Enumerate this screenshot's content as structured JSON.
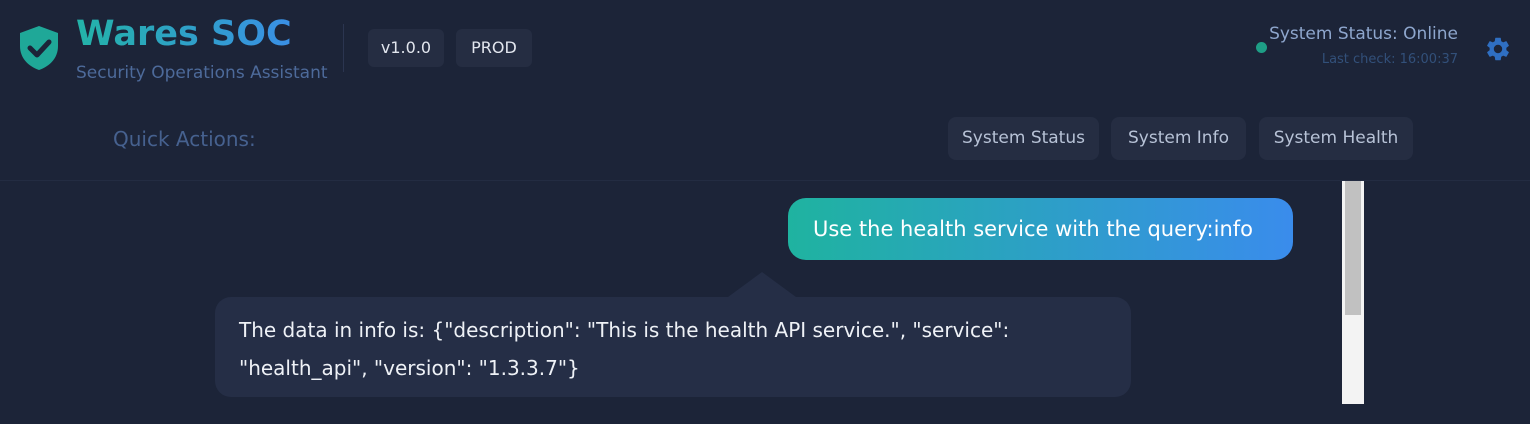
{
  "brand": {
    "title": "Wares SOC",
    "subtitle": "Security Operations Assistant",
    "logo_icon": "shield-check-icon"
  },
  "badges": {
    "version": "v1.0.0",
    "environment": "PROD"
  },
  "status": {
    "text": "System Status: Online",
    "last_check": "Last check: 16:00:37",
    "indicator_color": "#1e9e86"
  },
  "settings": {
    "icon": "gear-icon"
  },
  "quick_actions": {
    "label": "Quick Actions:",
    "buttons": [
      {
        "label": "System Status"
      },
      {
        "label": "System Info"
      },
      {
        "label": "System Health"
      }
    ]
  },
  "chat": {
    "messages": [
      {
        "role": "user",
        "text": "Use the health service with the query:info"
      },
      {
        "role": "assistant",
        "text": "The data in info is: {\"description\": \"This is the health API service.\", \"service\": \"health_api\", \"version\": \"1.3.3.7\"}"
      }
    ]
  },
  "colors": {
    "background": "#1c2438",
    "accent_gradient_start": "#1fb3a0",
    "accent_gradient_end": "#3a8cec",
    "bot_bubble": "#252e46"
  }
}
